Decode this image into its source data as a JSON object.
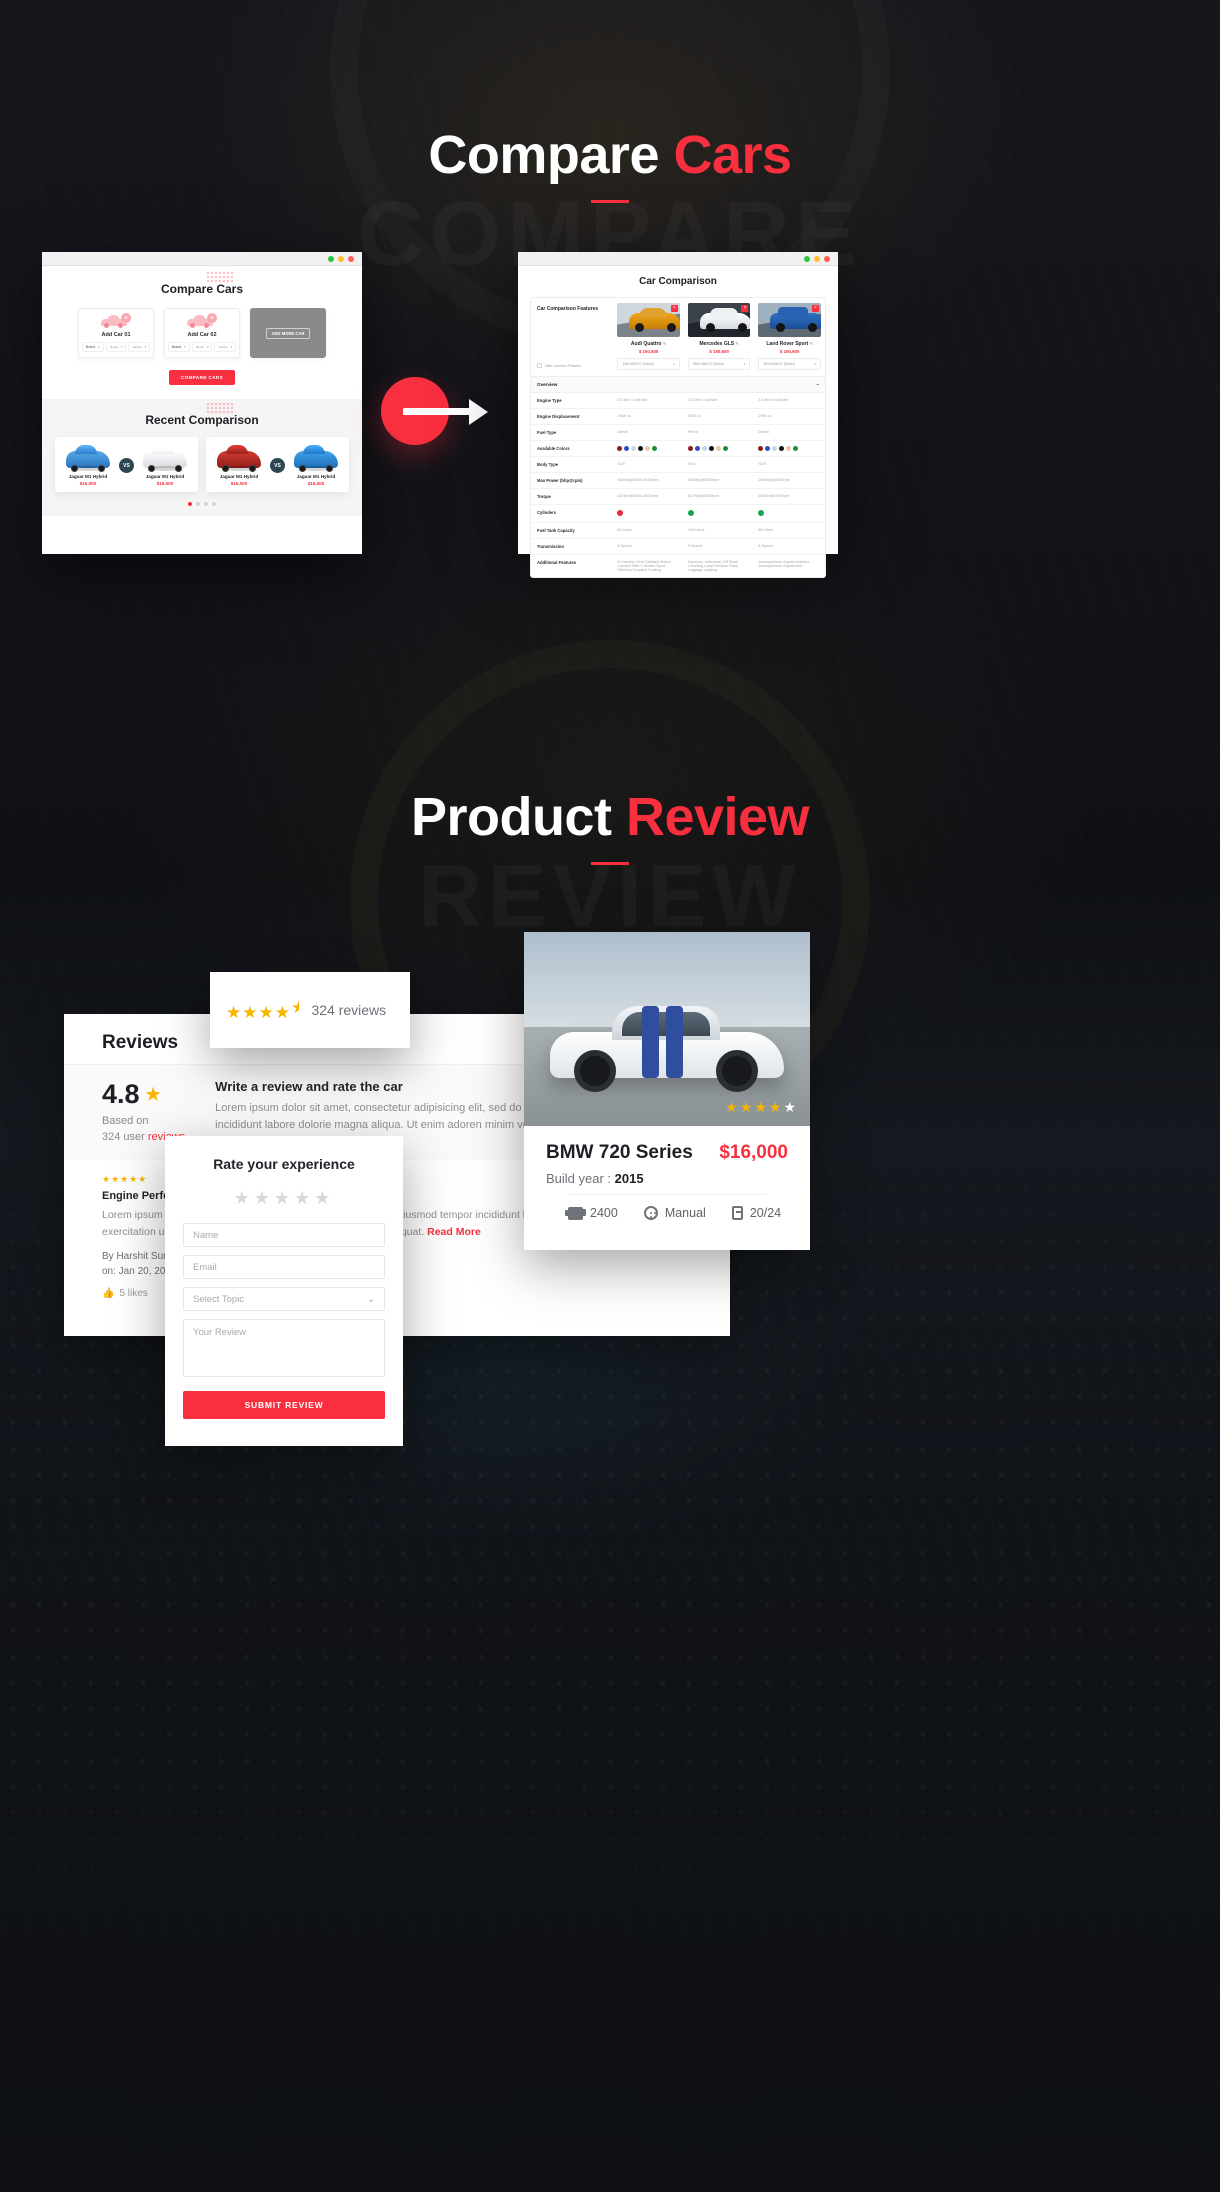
{
  "sections": {
    "compare": {
      "title_main": "Compare ",
      "title_accent": "Cars",
      "ghost": "COMPARE"
    },
    "review": {
      "title_main": "Product ",
      "title_accent": "Review",
      "ghost": "REVIEW"
    }
  },
  "compare_mockup": {
    "heading": "Compare Cars",
    "slots": [
      {
        "label": "Add Car 01",
        "brand": "Brand",
        "model": "Model",
        "variant": "Variant"
      },
      {
        "label": "Add Car 02",
        "brand": "Brand",
        "model": "Model",
        "variant": "Variant"
      }
    ],
    "add_more_label": "ADD MORE CAR",
    "compare_button": "COMPARE CARS",
    "recent_heading": "Recent Comparison",
    "recent": [
      {
        "left_name": "Jaguar M1 Hybrid",
        "left_price": "$16,000",
        "vs": "VS",
        "right_name": "Jaguar M1 Hybrid",
        "right_price": "$16,000"
      },
      {
        "left_name": "Jaguar M1 Hybrid",
        "left_price": "$16,000",
        "vs": "VS",
        "right_name": "Jaguar M1 Hybrid",
        "right_price": "$16,000"
      }
    ]
  },
  "comparison_mockup": {
    "heading": "Car Comparison",
    "features_label": "Car Comparison Features",
    "hide_common": "Hide Common Features",
    "cars": [
      {
        "name": "Audi Quattro",
        "price": "$ 150,600",
        "variant": "350d 4MATIC (Diesel)"
      },
      {
        "name": "Mercedes GLS",
        "price": "$ 150,600",
        "variant": "350d 4MATIC (Diesel)"
      },
      {
        "name": "Land Rover Sport",
        "price": "$ 150,600",
        "variant": "350d 4MATIC (Diesel)"
      }
    ],
    "section_row": "Overview",
    "rows": [
      {
        "label": "Engine Type",
        "values": [
          "2.0 litre 4 cylinder",
          "2.0 litre 4 cylinder",
          "3.0 litre 6 cylinder"
        ]
      },
      {
        "label": "Engine Displacement",
        "values": [
          "1968 cc",
          "5204 cc",
          "2993 cc"
        ]
      },
      {
        "label": "Fuel Type",
        "values": [
          "Diesel",
          "Petrol",
          "Diesel"
        ]
      },
      {
        "label": "Available Colors",
        "values": [
          "swatches",
          "swatches",
          "swatches"
        ]
      },
      {
        "label": "Body Type",
        "values": [
          "SUV",
          "SUV",
          "SUV"
        ]
      },
      {
        "label": "Max Power (bhp@rpm)",
        "values": [
          "448bhp@5000-6000rpm",
          "542bhp@5500rpm",
          "254bhp@4000rpm"
        ]
      },
      {
        "label": "Torque",
        "values": [
          "620Nm@1800-4500rpm",
          "617Nm@2000rpm",
          "600Nm@2000rpm"
        ]
      },
      {
        "label": "Cylinders",
        "values": [
          "no",
          "yes",
          "yes"
        ]
      },
      {
        "label": "Fuel Tank Capacity",
        "values": [
          "80 Litres",
          "100 Litres",
          "85 Litres"
        ]
      },
      {
        "label": "Transmission",
        "values": [
          "8 Speed",
          "9 Speed",
          "8 Speed"
        ]
      },
      {
        "label": "Additional Features",
        "values": [
          "8 Function Seat Detailed Select Comfort With 2 Modes Sport, Steering Coupled Cooling",
          "Dynamic, Individual, Off Road Lowering Load Function Easy Luggage Loading",
          "Airsuspension Speed baseline Airsuspension Adjustment"
        ]
      }
    ],
    "colors": [
      "#8c1b1b",
      "#2f4ecb",
      "#c7d4ea",
      "#111111",
      "#e8cba0",
      "#1d8f3b"
    ]
  },
  "rating_card": {
    "stars": "★★★★",
    "half": "★",
    "count": "324 reviews"
  },
  "reviews_panel": {
    "heading": "Reviews",
    "score": "4.8",
    "score_star": "★",
    "based_on_line1": "Based on",
    "based_on_line2": "324 user ",
    "based_on_link": "reviews",
    "write_title": "Write a review and rate the car",
    "write_body": "Lorem ipsum dolor sit amet, consectetur adipisicing elit, sed do them and eiusmod tempor incididunt labore dolorie magna aliqua. Ut enim adoren minim venim",
    "item": {
      "stars": "★★★★★",
      "title": "Engine Performance",
      "body": "Lorem ipsum dolor sit amet, consectetur adipisicing elit, sed do eiusmod tempor incididunt labore minim venim, quis nostrud exercitation ullamco laboris nisi ut aliquip ex ea commodo consequat.",
      "read_more": "Read More",
      "by": "By Harshit Sunny",
      "on": "on: Jan 20, 2019",
      "likes": "5 likes"
    }
  },
  "rate_form": {
    "heading": "Rate your experience",
    "stars": "★★★★★",
    "name_placeholder": "Name",
    "email_placeholder": "Email",
    "topic_placeholder": "Select Topic",
    "review_placeholder": "Your Review",
    "submit_label": "SUBMIT REVIEW"
  },
  "car_card": {
    "stars": "★★★★",
    "star_off": "★",
    "model": "BMW 720 Series",
    "price": "$16,000",
    "build_year_label": "Build year :",
    "build_year_value": "2015",
    "specs": [
      {
        "icon": "engine-icon",
        "value": "2400"
      },
      {
        "icon": "transmission-icon",
        "value": "Manual"
      },
      {
        "icon": "fuel-icon",
        "value": "20/24"
      }
    ]
  },
  "colors": {
    "accent": "#f72f3e",
    "star": "#f7b500",
    "dark": "#14161c"
  }
}
